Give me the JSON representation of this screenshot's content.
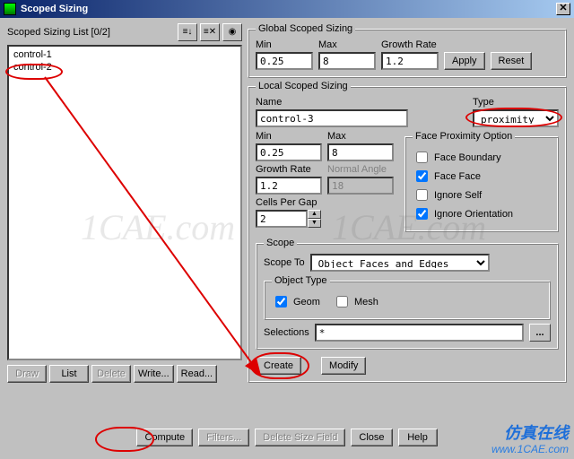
{
  "title": "Scoped Sizing",
  "list": {
    "label": "Scoped Sizing List [0/2]",
    "items": [
      "control-1",
      "control-2"
    ]
  },
  "buttons": {
    "apply": "Apply",
    "reset": "Reset",
    "create": "Create",
    "modify": "Modify",
    "draw": "Draw",
    "list": "List",
    "delete": "Delete",
    "write": "Write...",
    "read": "Read...",
    "compute": "Compute",
    "filters": "Filters...",
    "delete_field": "Delete Size Field",
    "close": "Close",
    "help": "Help"
  },
  "global": {
    "legend": "Global Scoped Sizing",
    "min_label": "Min",
    "min": "0.25",
    "max_label": "Max",
    "max": "8",
    "gr_label": "Growth Rate",
    "gr": "1.2"
  },
  "local": {
    "legend": "Local Scoped Sizing",
    "name_label": "Name",
    "name": "control-3",
    "type_label": "Type",
    "type": "proximity",
    "min_label": "Min",
    "min": "0.25",
    "max_label": "Max",
    "max": "8",
    "gr_label": "Growth Rate",
    "gr": "1.2",
    "na_label": "Normal Angle",
    "na": "18",
    "cpg_label": "Cells Per Gap",
    "cpg": "2",
    "fpo": {
      "legend": "Face Proximity Option",
      "fb": "Face Boundary",
      "ff": "Face Face",
      "is": "Ignore Self",
      "io": "Ignore Orientation"
    },
    "scope": {
      "legend": "Scope",
      "to_label": "Scope To",
      "to": "Object Faces and Edges",
      "ot_legend": "Object Type",
      "geom": "Geom",
      "mesh": "Mesh",
      "sel_label": "Selections",
      "sel": "*"
    }
  },
  "branding": {
    "name": "仿真在线",
    "url": "www.1CAE.com"
  }
}
